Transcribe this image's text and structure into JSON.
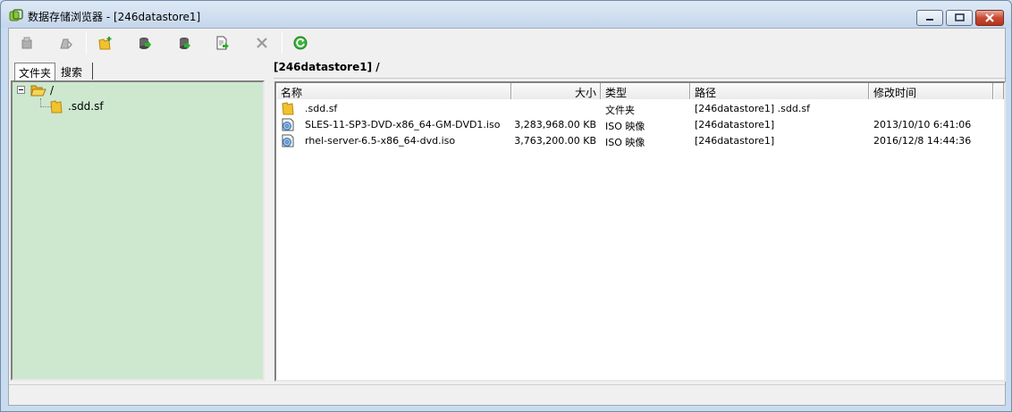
{
  "window": {
    "title": "数据存储浏览器 - [246datastore1]",
    "accent_color": "#c9dbef",
    "close_color": "#c74a35"
  },
  "toolbar": {
    "buttons": [
      {
        "icon": "upload-icon"
      },
      {
        "icon": "download-icon"
      },
      {
        "icon": "new-folder-icon"
      },
      {
        "icon": "upload-file-icon"
      },
      {
        "icon": "download-file-icon"
      },
      {
        "icon": "move-file-icon"
      },
      {
        "icon": "delete-icon"
      },
      {
        "icon": "refresh-icon"
      }
    ]
  },
  "left_panel": {
    "tabs": [
      {
        "label": "文件夹"
      },
      {
        "label": "搜索"
      }
    ],
    "tree": [
      {
        "label": "/",
        "icon": "open-folder-icon"
      },
      {
        "label": ".sdd.sf",
        "icon": "folder-icon"
      }
    ],
    "background_color": "#cde8cf"
  },
  "right_panel": {
    "path": "[246datastore1] /",
    "columns": {
      "name": "名称",
      "size": "大小",
      "type": "类型",
      "path": "路径",
      "modified": "修改时间"
    },
    "rows": [
      {
        "icon": "folder-icon",
        "name": ".sdd.sf",
        "size": "",
        "type": "文件夹",
        "path": "[246datastore1] .sdd.sf",
        "modified": ""
      },
      {
        "icon": "disc-image-icon",
        "name": "SLES-11-SP3-DVD-x86_64-GM-DVD1.iso",
        "size": "3,283,968.00 KB",
        "type": "ISO 映像",
        "path": "[246datastore1]",
        "modified": "2013/10/10 6:41:06"
      },
      {
        "icon": "disc-image-icon",
        "name": "rhel-server-6.5-x86_64-dvd.iso",
        "size": "3,763,200.00 KB",
        "type": "ISO 映像",
        "path": "[246datastore1]",
        "modified": "2016/12/8 14:44:36"
      }
    ]
  }
}
